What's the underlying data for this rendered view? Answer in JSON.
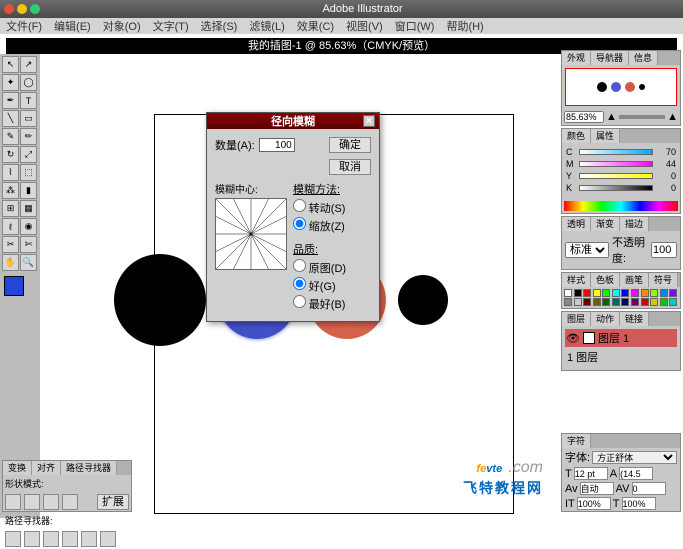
{
  "app_title": "Adobe Illustrator",
  "menu": [
    "文件(F)",
    "编辑(E)",
    "对象(O)",
    "文字(T)",
    "选择(S)",
    "滤镜(L)",
    "效果(C)",
    "视图(V)",
    "窗口(W)",
    "帮助(H)"
  ],
  "doc_title": "我的插图-1 @ 85.63%（CMYK/预览）",
  "dialog": {
    "title": "径向模糊",
    "amount_label": "数量(A):",
    "amount_value": "100",
    "ok": "确定",
    "cancel": "取消",
    "center_label": "模糊中心:",
    "method_label": "模糊方法:",
    "method_options": [
      "转动(S)",
      "缩放(Z)"
    ],
    "quality_label": "品质:",
    "quality_options": [
      "原图(D)",
      "好(G)",
      "最好(B)"
    ]
  },
  "navigator": {
    "tabs": [
      "外观",
      "导航器",
      "信息"
    ],
    "zoom": "85.63%"
  },
  "color": {
    "tabs": [
      "颜色",
      "属性"
    ],
    "sliders": [
      {
        "label": "C",
        "value": "70"
      },
      {
        "label": "M",
        "value": "44"
      },
      {
        "label": "Y",
        "value": "0"
      },
      {
        "label": "K",
        "value": "0"
      }
    ]
  },
  "transparency": {
    "tabs": [
      "透明",
      "渐变",
      "描边"
    ],
    "mode": "标准",
    "opacity_label": "不透明度:",
    "opacity": "100"
  },
  "swatches": {
    "tabs": [
      "样式",
      "色板",
      "画笔",
      "符号"
    ],
    "colors": [
      "#fff",
      "#000",
      "#f00",
      "#ff0",
      "#0f0",
      "#0ff",
      "#00f",
      "#f0f",
      "#f80",
      "#8f0",
      "#08f",
      "#80f",
      "#888",
      "#ccc",
      "#600",
      "#660",
      "#060",
      "#066",
      "#006",
      "#606",
      "#c00",
      "#cc0",
      "#0c0",
      "#0cc"
    ]
  },
  "layers": {
    "tabs": [
      "图层",
      "动作",
      "链接"
    ],
    "layer_name": "图层 1",
    "count": "1 图层"
  },
  "pathfinder": {
    "tabs": [
      "变换",
      "对齐",
      "路径寻找器"
    ],
    "label1": "形状模式:",
    "label2": "路径寻找器:",
    "expand": "扩展"
  },
  "character": {
    "tab": "字符",
    "font": "方正舒体",
    "size": "12 pt",
    "leading": "(14.5",
    "tracking": "0",
    "kerning": "自动",
    "hscale": "100%",
    "vscale": "100%"
  },
  "watermark": {
    "brand": "fevte",
    "suffix": ".com",
    "cn": "飞特教程网"
  }
}
